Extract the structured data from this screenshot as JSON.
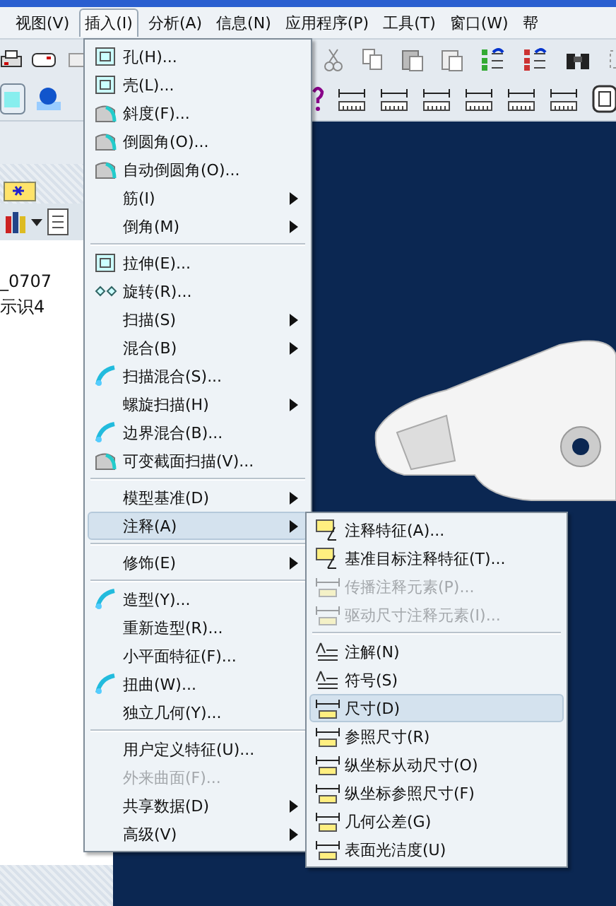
{
  "menubar": [
    {
      "label": "视图(V)",
      "selected": false
    },
    {
      "label": "插入(I)",
      "selected": true
    },
    {
      "label": "分析(A)",
      "selected": false
    },
    {
      "label": "信息(N)",
      "selected": false
    },
    {
      "label": "应用程序(P)",
      "selected": false
    },
    {
      "label": "工具(T)",
      "selected": false
    },
    {
      "label": "窗口(W)",
      "selected": false
    },
    {
      "label": "帮",
      "selected": false
    }
  ],
  "model_tree": {
    "lines": [
      "_0707",
      "示识4"
    ]
  },
  "insert_menu": {
    "groups": [
      [
        {
          "label": "孔(H)...",
          "submenu": false,
          "selected": false,
          "disabled": false
        },
        {
          "label": "壳(L)...",
          "submenu": false,
          "selected": false,
          "disabled": false
        },
        {
          "label": "斜度(F)...",
          "submenu": false,
          "selected": false,
          "disabled": false
        },
        {
          "label": "倒圆角(O)...",
          "submenu": false,
          "selected": false,
          "disabled": false
        },
        {
          "label": "自动倒圆角(O)...",
          "submenu": false,
          "selected": false,
          "disabled": false
        },
        {
          "label": "筋(I)",
          "submenu": true,
          "selected": false,
          "disabled": false
        },
        {
          "label": "倒角(M)",
          "submenu": true,
          "selected": false,
          "disabled": false
        }
      ],
      [
        {
          "label": "拉伸(E)...",
          "submenu": false,
          "selected": false,
          "disabled": false
        },
        {
          "label": "旋转(R)...",
          "submenu": false,
          "selected": false,
          "disabled": false
        },
        {
          "label": "扫描(S)",
          "submenu": true,
          "selected": false,
          "disabled": false
        },
        {
          "label": "混合(B)",
          "submenu": true,
          "selected": false,
          "disabled": false
        },
        {
          "label": "扫描混合(S)...",
          "submenu": false,
          "selected": false,
          "disabled": false
        },
        {
          "label": "螺旋扫描(H)",
          "submenu": true,
          "selected": false,
          "disabled": false
        },
        {
          "label": "边界混合(B)...",
          "submenu": false,
          "selected": false,
          "disabled": false
        },
        {
          "label": "可变截面扫描(V)...",
          "submenu": false,
          "selected": false,
          "disabled": false
        }
      ],
      [
        {
          "label": "模型基准(D)",
          "submenu": true,
          "selected": false,
          "disabled": false
        },
        {
          "label": "注释(A)",
          "submenu": true,
          "selected": true,
          "disabled": false
        }
      ],
      [
        {
          "label": "修饰(E)",
          "submenu": true,
          "selected": false,
          "disabled": false
        }
      ],
      [
        {
          "label": "造型(Y)...",
          "submenu": false,
          "selected": false,
          "disabled": false
        },
        {
          "label": "重新造型(R)...",
          "submenu": false,
          "selected": false,
          "disabled": false
        },
        {
          "label": "小平面特征(F)...",
          "submenu": false,
          "selected": false,
          "disabled": false
        },
        {
          "label": "扭曲(W)...",
          "submenu": false,
          "selected": false,
          "disabled": false
        },
        {
          "label": "独立几何(Y)...",
          "submenu": false,
          "selected": false,
          "disabled": false
        }
      ],
      [
        {
          "label": "用户定义特征(U)...",
          "submenu": false,
          "selected": false,
          "disabled": false
        },
        {
          "label": "外来曲面(F)...",
          "submenu": false,
          "selected": false,
          "disabled": true
        },
        {
          "label": "共享数据(D)",
          "submenu": true,
          "selected": false,
          "disabled": false
        },
        {
          "label": "高级(V)",
          "submenu": true,
          "selected": false,
          "disabled": false
        }
      ]
    ]
  },
  "annotation_submenu": {
    "groups": [
      [
        {
          "label": "注释特征(A)...",
          "selected": false,
          "disabled": false
        },
        {
          "label": "基准目标注释特征(T)...",
          "selected": false,
          "disabled": false
        },
        {
          "label": "传播注释元素(P)...",
          "selected": false,
          "disabled": true
        },
        {
          "label": "驱动尺寸注释元素(I)...",
          "selected": false,
          "disabled": true
        }
      ],
      [
        {
          "label": "注解(N)",
          "selected": false,
          "disabled": false
        },
        {
          "label": "符号(S)",
          "selected": false,
          "disabled": false
        },
        {
          "label": "尺寸(D)",
          "selected": true,
          "disabled": false
        },
        {
          "label": "参照尺寸(R)",
          "selected": false,
          "disabled": false
        },
        {
          "label": "纵坐标从动尺寸(O)",
          "selected": false,
          "disabled": false
        },
        {
          "label": "纵坐标参照尺寸(F)",
          "selected": false,
          "disabled": false
        },
        {
          "label": "几何公差(G)",
          "selected": false,
          "disabled": false
        },
        {
          "label": "表面光洁度(U)",
          "selected": false,
          "disabled": false
        }
      ]
    ]
  }
}
